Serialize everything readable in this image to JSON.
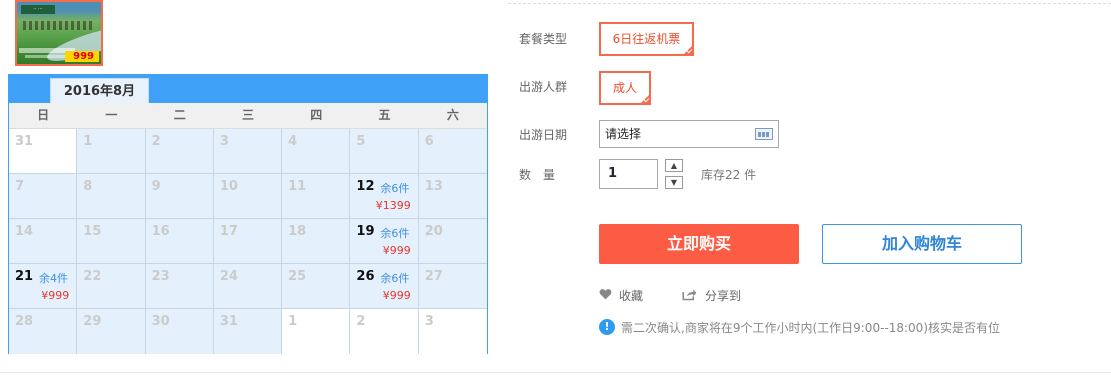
{
  "product": {
    "thumb_price": "999",
    "thumb_logo": "·· ···"
  },
  "calendar": {
    "month": "2016年8月",
    "weekdays": [
      "日",
      "一",
      "二",
      "三",
      "四",
      "五",
      "六"
    ],
    "cells": [
      {
        "day": "31",
        "white": true
      },
      {
        "day": "1"
      },
      {
        "day": "2"
      },
      {
        "day": "3"
      },
      {
        "day": "4"
      },
      {
        "day": "5"
      },
      {
        "day": "6"
      },
      {
        "day": "7"
      },
      {
        "day": "8"
      },
      {
        "day": "9"
      },
      {
        "day": "10"
      },
      {
        "day": "11"
      },
      {
        "day": "12",
        "stock": "余6件",
        "price": "¥1399",
        "available": true
      },
      {
        "day": "13"
      },
      {
        "day": "14"
      },
      {
        "day": "15"
      },
      {
        "day": "16"
      },
      {
        "day": "17"
      },
      {
        "day": "18"
      },
      {
        "day": "19",
        "stock": "余6件",
        "price": "¥999",
        "available": true
      },
      {
        "day": "20"
      },
      {
        "day": "21",
        "stock": "余4件",
        "price": "¥999",
        "available": true
      },
      {
        "day": "22"
      },
      {
        "day": "23"
      },
      {
        "day": "24"
      },
      {
        "day": "25"
      },
      {
        "day": "26",
        "stock": "余6件",
        "price": "¥999",
        "available": true
      },
      {
        "day": "27"
      },
      {
        "day": "28"
      },
      {
        "day": "29"
      },
      {
        "day": "30"
      },
      {
        "day": "31"
      },
      {
        "day": "1",
        "white": true
      },
      {
        "day": "2",
        "white": true
      },
      {
        "day": "3",
        "white": true
      }
    ]
  },
  "form": {
    "package_label": "套餐类型",
    "package_value": "6日往返机票",
    "group_label": "出游人群",
    "group_value": "成人",
    "date_label": "出游日期",
    "date_placeholder": "请选择",
    "qty_label": "数　量",
    "qty_value": "1",
    "stepper_up": "▲",
    "stepper_down": "▼",
    "stock_text": "库存22 件"
  },
  "buttons": {
    "buy_now": "立即购买",
    "add_to_cart": "加入购物车"
  },
  "actions": {
    "favorite": "收藏",
    "share": "分享到"
  },
  "notice": {
    "text": "需二次确认,商家将在9个工作小时内(工作日9:00--18:00)核实是否有位"
  },
  "colors": {
    "accent_orange": "#fd5c44",
    "calendar_blue": "#3ea0f6",
    "cell_bg": "#e4f1fd",
    "price_red": "#e8352f",
    "stock_blue": "#3e8fe0"
  }
}
